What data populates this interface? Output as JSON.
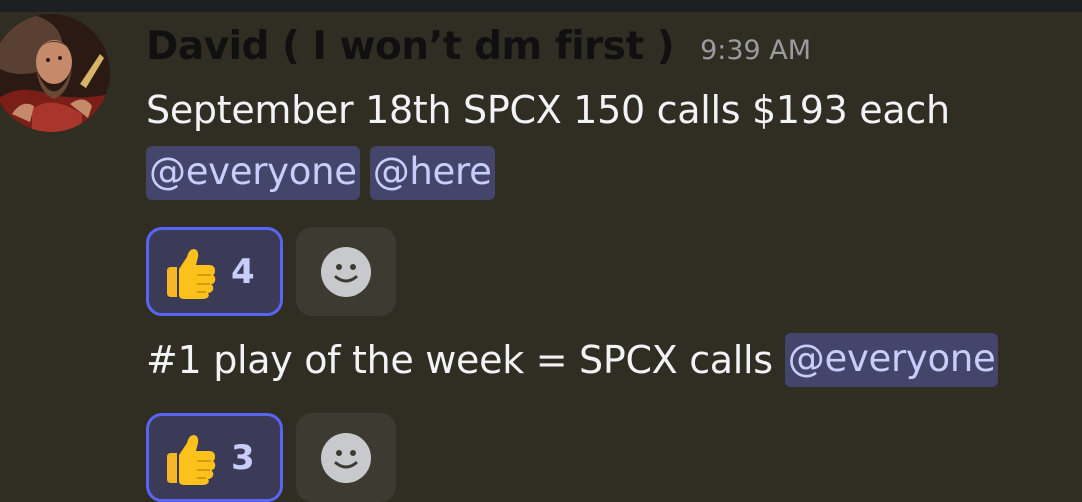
{
  "message": {
    "author": "David ( I won’t dm first )",
    "timestamp": "9:39 AM",
    "line1": "September 18th SPCX 150 calls $193 each",
    "mentions1": [
      "@everyone",
      "@here"
    ],
    "line2_text": "#1 play of the week = SPCX calls",
    "line2_mention": "@everyone"
  },
  "reactions": [
    {
      "emoji": "thumbs-up-icon",
      "count": "4"
    },
    {
      "emoji": "thumbs-up-icon",
      "count": "3"
    }
  ],
  "colors": {
    "background": "#302d23",
    "mention_bg": "#44456a",
    "mention_text": "#c9cdfb",
    "reaction_border": "#5865f2"
  }
}
